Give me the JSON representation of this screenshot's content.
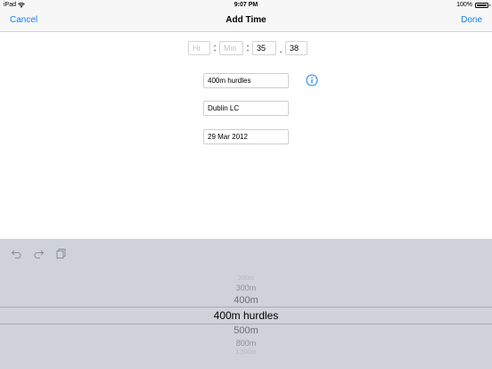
{
  "status_bar": {
    "device": "iPad",
    "time": "9:07 PM",
    "battery": "100%"
  },
  "nav": {
    "cancel": "Cancel",
    "title": "Add Time",
    "done": "Done"
  },
  "time_inputs": {
    "hr_placeholder": "Hr",
    "min_placeholder": "Min",
    "sec_value": "35",
    "hundredths_value": "38",
    "sep1": ":",
    "sep2": ":",
    "sep3": "."
  },
  "form": {
    "event": "400m hurdles",
    "venue": "Dublin LC",
    "date": "29 Mar 2012"
  },
  "picker": {
    "items": [
      "200m",
      "300m",
      "400m",
      "400m hurdles",
      "500m",
      "800m",
      "1,500m"
    ],
    "selected": "400m hurdles"
  },
  "colors": {
    "accent": "#147efb",
    "keyboard_bg": "#cfd3d9"
  }
}
